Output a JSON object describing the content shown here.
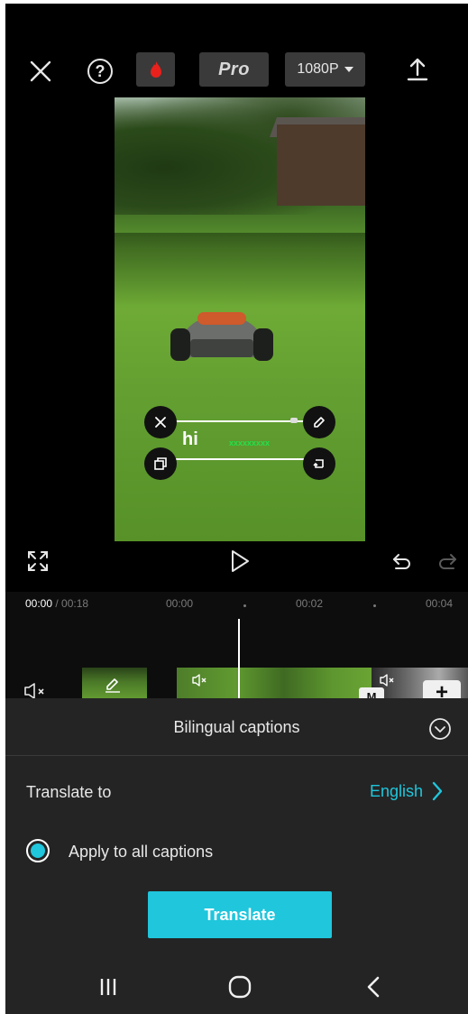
{
  "topbar": {
    "pro_label": "Pro",
    "resolution_label": "1080P"
  },
  "caption": {
    "text": "hi",
    "translated_text": "xxxxxxxxx"
  },
  "timeline": {
    "current_time": "00:00",
    "total_time": "/ 00:18",
    "marks": [
      "00:00",
      "00:02",
      "00:04"
    ],
    "add_label": "+",
    "tag_label": "M"
  },
  "sheet": {
    "title": "Bilingual captions",
    "translate_to_label": "Translate to",
    "language": "English",
    "apply_all_label": "Apply to all captions",
    "apply_all_checked": true,
    "translate_button": "Translate"
  },
  "colors": {
    "accent": "#1fc6dc",
    "background": "#000000",
    "sheet_background": "#242424"
  },
  "icons": [
    "close-icon",
    "help-icon",
    "fire-icon",
    "chevron-down-icon",
    "export-icon",
    "fullscreen-icon",
    "play-icon",
    "undo-icon",
    "redo-icon",
    "speaker-muted-icon",
    "pencil-icon",
    "collapse-icon",
    "chevron-right-icon",
    "recents-icon",
    "home-icon",
    "back-icon"
  ]
}
